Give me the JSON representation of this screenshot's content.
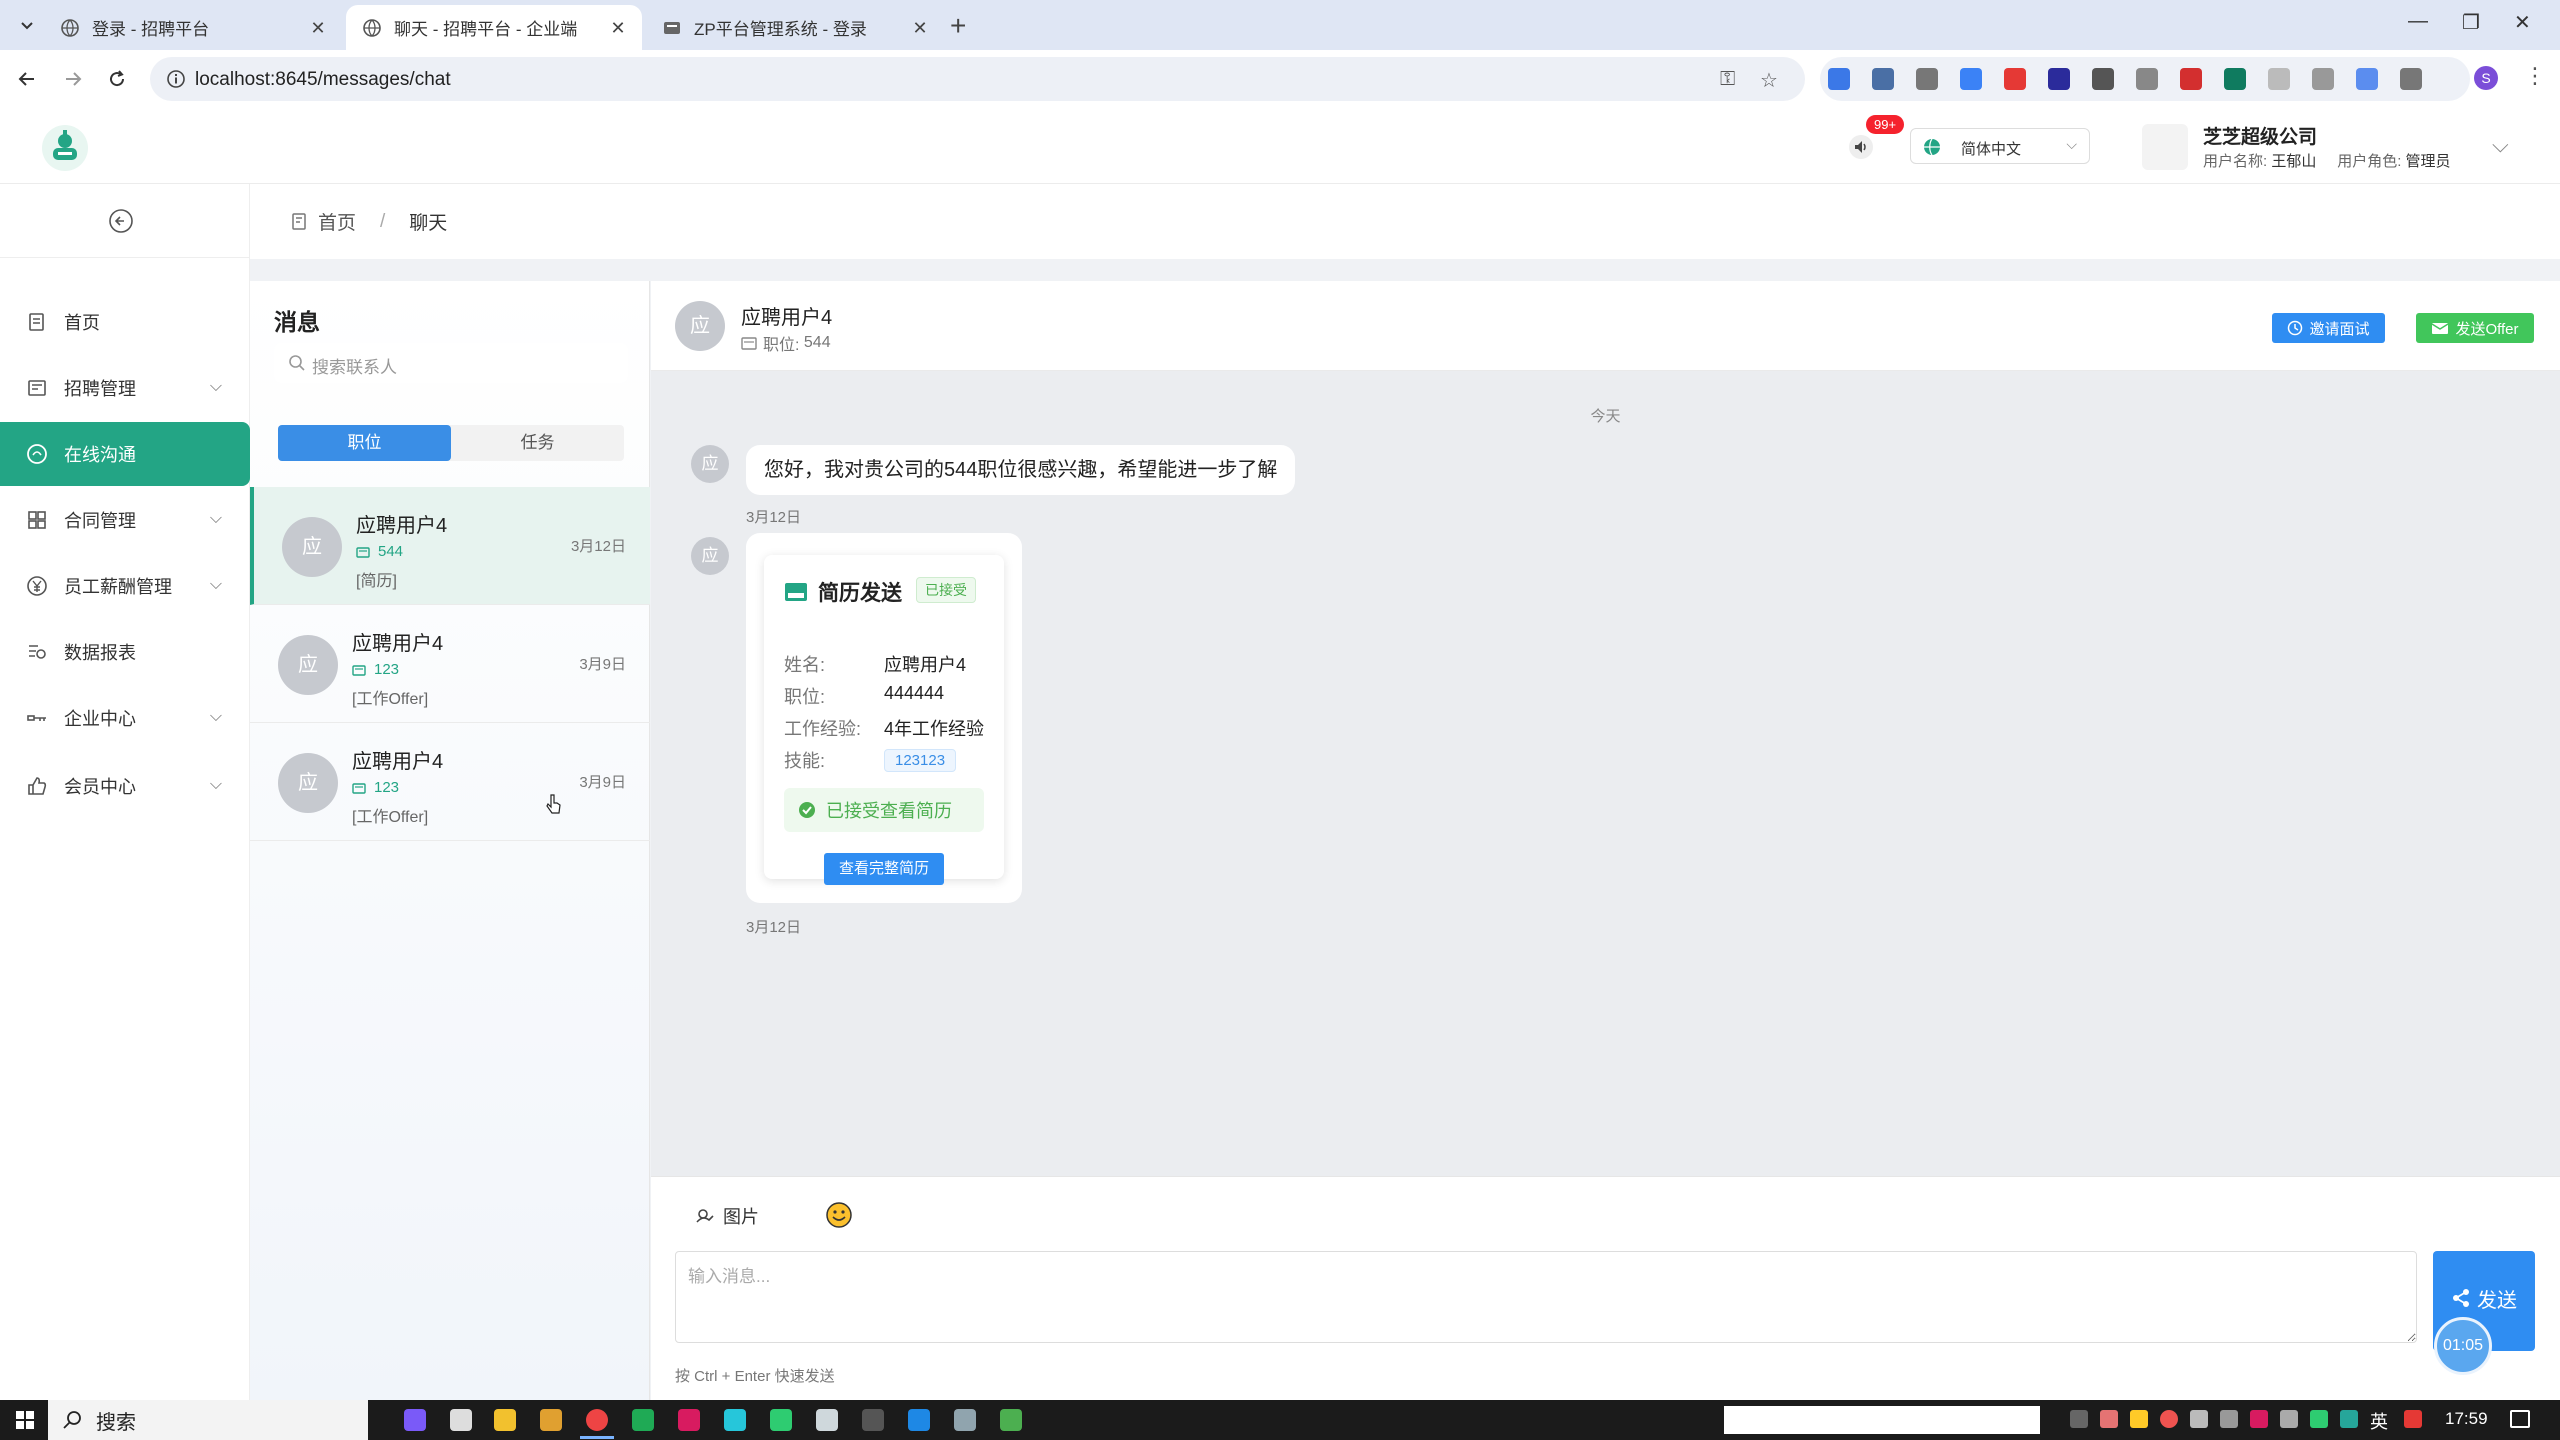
{
  "browser": {
    "tabs": [
      {
        "title": "登录 - 招聘平台",
        "active": false
      },
      {
        "title": "聊天 - 招聘平台 - 企业端",
        "active": true
      },
      {
        "title": "ZP平台管理系统 - 登录",
        "active": false
      }
    ],
    "url": "localhost:8645/messages/chat",
    "profile_initial": "S"
  },
  "header": {
    "notification_count": "99+",
    "language": "简体中文",
    "company": "芝芝超级公司",
    "username_label": "用户名称:",
    "username": "王郁山",
    "role_label": "用户角色:",
    "role": "管理员"
  },
  "sidebar": {
    "items": [
      {
        "label": "首页",
        "icon": "home-icon",
        "has_children": false
      },
      {
        "label": "招聘管理",
        "icon": "recruit-icon",
        "has_children": true
      },
      {
        "label": "在线沟通",
        "icon": "chat-icon",
        "has_children": false,
        "active": true
      },
      {
        "label": "合同管理",
        "icon": "contract-icon",
        "has_children": true
      },
      {
        "label": "员工薪酬管理",
        "icon": "salary-icon",
        "has_children": true
      },
      {
        "label": "数据报表",
        "icon": "report-icon",
        "has_children": false
      },
      {
        "label": "企业中心",
        "icon": "enterprise-icon",
        "has_children": true
      },
      {
        "label": "会员中心",
        "icon": "member-icon",
        "has_children": true
      }
    ]
  },
  "breadcrumb": {
    "home": "首页",
    "separator": "/",
    "current": "聊天"
  },
  "contacts": {
    "title": "消息",
    "search_placeholder": "搜索联系人",
    "tabs": [
      "职位",
      "任务"
    ],
    "list": [
      {
        "avatar": "应",
        "name": "应聘用户4",
        "job": "544",
        "last_msg": "[简历]",
        "date": "3月12日",
        "active": true
      },
      {
        "avatar": "应",
        "name": "应聘用户4",
        "job": "123",
        "last_msg": "[工作Offer]",
        "date": "3月9日",
        "active": false
      },
      {
        "avatar": "应",
        "name": "应聘用户4",
        "job": "123",
        "last_msg": "[工作Offer]",
        "date": "3月9日",
        "active": false
      }
    ]
  },
  "chat": {
    "avatar": "应",
    "name": "应聘用户4",
    "job_label": "职位:",
    "job": "544",
    "interview_button": "邀请面试",
    "offer_button": "发送Offer",
    "day_divider": "今天",
    "messages": [
      {
        "avatar": "应",
        "text": "您好，我对贵公司的544职位很感兴趣，希望能进一步了解",
        "time": "3月12日"
      }
    ],
    "resume_card": {
      "avatar": "应",
      "title": "简历发送",
      "status": "已接受",
      "fields": [
        {
          "label": "姓名:",
          "value": "应聘用户4"
        },
        {
          "label": "职位:",
          "value": "444444"
        },
        {
          "label": "工作经验:",
          "value": "4年工作经验"
        }
      ],
      "skills_label": "技能:",
      "skill": "123123",
      "accepted_text": "已接受查看简历",
      "view_button": "查看完整简历",
      "time": "3月12日"
    },
    "composer": {
      "image_button": "图片",
      "placeholder": "输入消息...",
      "send_button": "发送",
      "timer": "01:05",
      "hint": "按 Ctrl + Enter 快速发送"
    }
  },
  "taskbar": {
    "search": "搜索",
    "ime": "英",
    "time": "17:59"
  },
  "colors": {
    "primary": "#23a585",
    "blue": "#2f8df2",
    "green": "#41c65b",
    "badge": "#f5222d"
  }
}
